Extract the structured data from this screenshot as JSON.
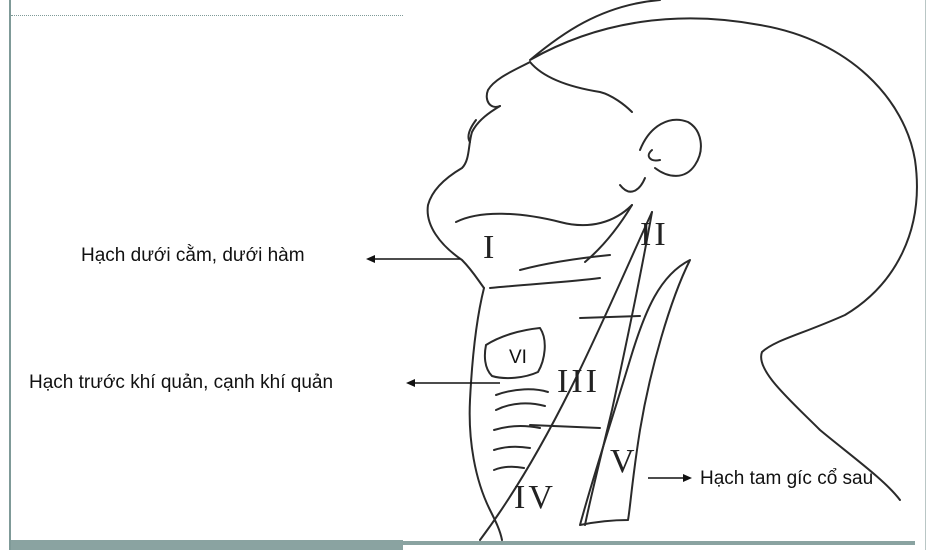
{
  "labels": {
    "submandibular": "Hạch dưới cằm, dưới hàm",
    "pretracheal": "Hạch trước khí quản, cạnh khí quản",
    "posterior_triangle": "Hạch tam gíc cổ sau"
  },
  "levels": {
    "I": "I",
    "II": "II",
    "III": "III",
    "IV": "IV",
    "V": "V",
    "VI": "VI"
  },
  "colors": {
    "frame": "#8aa3a1",
    "line": "#2a2a2a"
  }
}
